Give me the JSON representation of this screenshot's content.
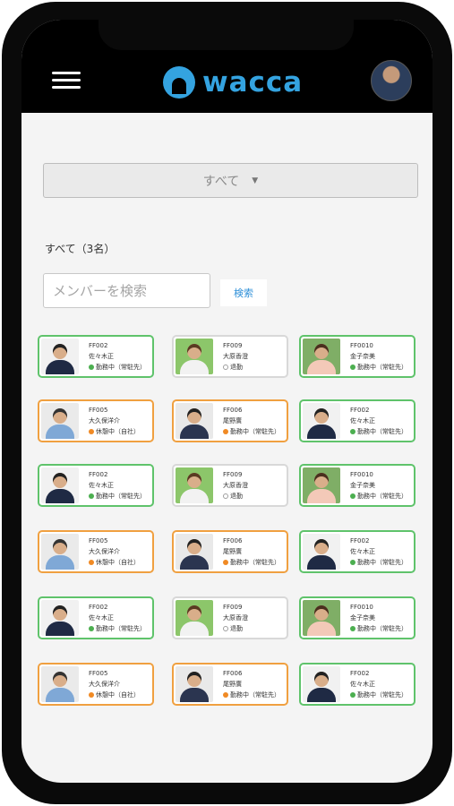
{
  "header": {
    "brand": "wacca"
  },
  "filter": {
    "selected": "すべて"
  },
  "summary": {
    "count_label": "すべて（3名）"
  },
  "search": {
    "placeholder": "メンバーを検索",
    "button_label": "検索"
  },
  "members": [
    {
      "id": "FF002",
      "name": "佐々木正",
      "status": "勤務中（常駐先）",
      "state": "working"
    },
    {
      "id": "FF009",
      "name": "大原香澄",
      "status": "退勤",
      "state": "off"
    },
    {
      "id": "FF0010",
      "name": "金子奈美",
      "status": "勤務中（常駐先）",
      "state": "working"
    },
    {
      "id": "FF005",
      "name": "大久保洋介",
      "status": "休憩中（自社）",
      "state": "break"
    },
    {
      "id": "FF006",
      "name": "尾野廣",
      "status": "勤務中（常駐先）",
      "state": "break-working"
    },
    {
      "id": "FF002",
      "name": "佐々木正",
      "status": "勤務中（常駐先）",
      "state": "working"
    },
    {
      "id": "FF002",
      "name": "佐々木正",
      "status": "勤務中（常駐先）",
      "state": "working"
    },
    {
      "id": "FF009",
      "name": "大原香澄",
      "status": "退勤",
      "state": "off"
    },
    {
      "id": "FF0010",
      "name": "金子奈美",
      "status": "勤務中（常駐先）",
      "state": "working"
    },
    {
      "id": "FF005",
      "name": "大久保洋介",
      "status": "休憩中（自社）",
      "state": "break"
    },
    {
      "id": "FF006",
      "name": "尾野廣",
      "status": "勤務中（常駐先）",
      "state": "break-working"
    },
    {
      "id": "FF002",
      "name": "佐々木正",
      "status": "勤務中（常駐先）",
      "state": "working"
    },
    {
      "id": "FF002",
      "name": "佐々木正",
      "status": "勤務中（常駐先）",
      "state": "working"
    },
    {
      "id": "FF009",
      "name": "大原香澄",
      "status": "退勤",
      "state": "off"
    },
    {
      "id": "FF0010",
      "name": "金子奈美",
      "status": "勤務中（常駐先）",
      "state": "working"
    },
    {
      "id": "FF005",
      "name": "大久保洋介",
      "status": "休憩中（自社）",
      "state": "break"
    },
    {
      "id": "FF006",
      "name": "尾野廣",
      "status": "勤務中（常駐先）",
      "state": "break-working"
    },
    {
      "id": "FF002",
      "name": "佐々木正",
      "status": "勤務中（常駐先）",
      "state": "working"
    }
  ],
  "colors": {
    "accent": "#34a3e0",
    "working": "#4caf50",
    "break": "#f08a24",
    "off": "#9e9e9e"
  }
}
